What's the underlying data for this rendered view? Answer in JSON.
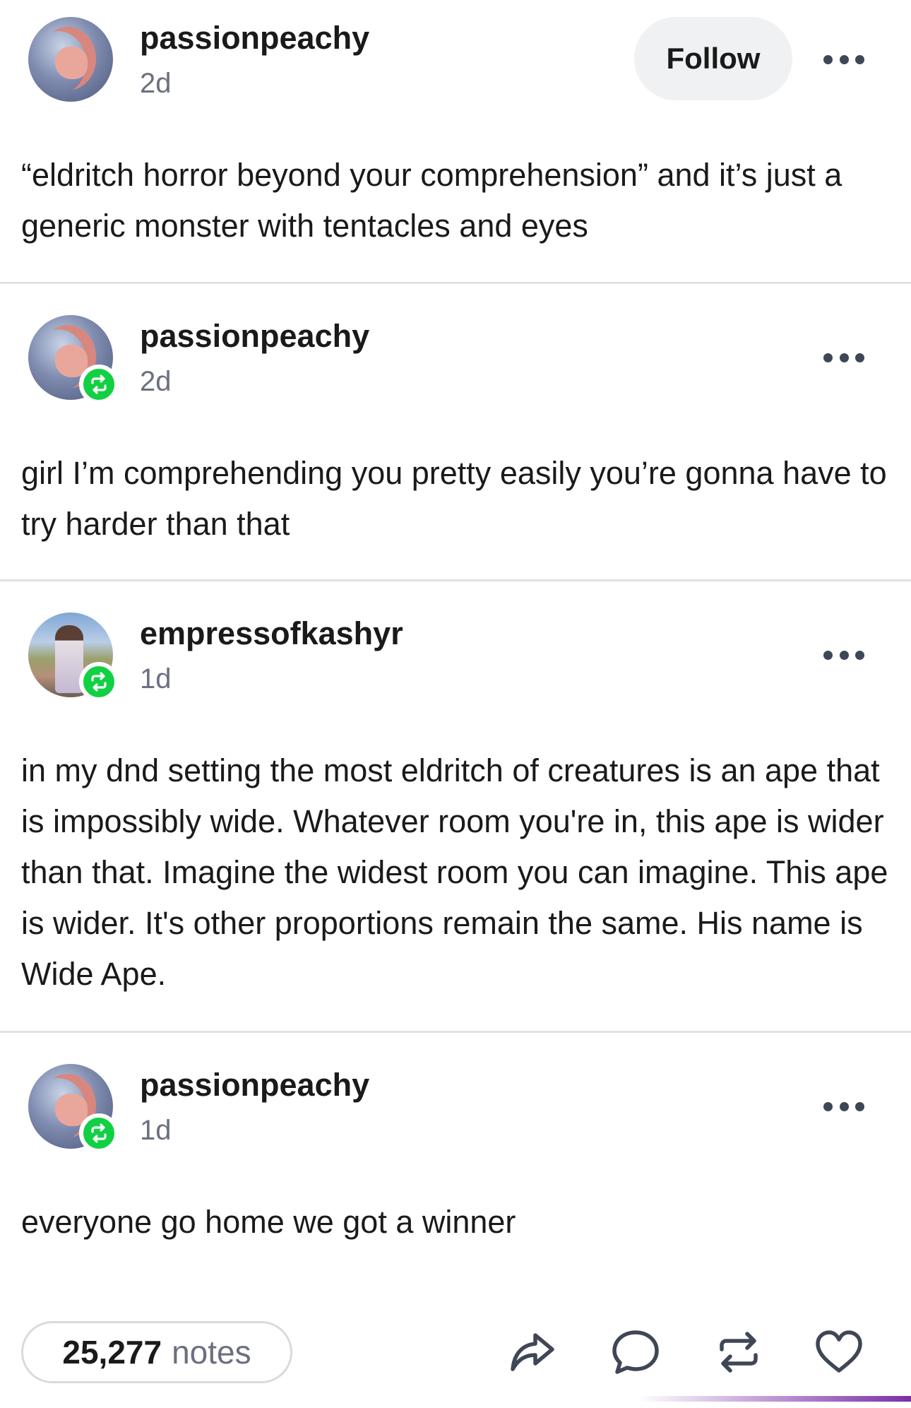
{
  "posts": [
    {
      "username": "passionpeachy",
      "time": "2d",
      "follow_label": "Follow",
      "text": "“eldritch horror beyond your comprehension” and it’s just a generic monster with tentacles and eyes"
    },
    {
      "username": "passionpeachy",
      "time": "2d",
      "text": "girl I’m comprehending you pretty easily you’re gonna have to try harder than that"
    },
    {
      "username": "empressofkashyr",
      "time": "1d",
      "text": "in my dnd setting the most eldritch of creatures is an ape that is impossibly wide. Whatever room you're in, this ape is wider than that. Imagine the widest room you can imagine. This ape is wider. It's other proportions remain the same. His name is Wide Ape."
    },
    {
      "username": "passionpeachy",
      "time": "1d",
      "text": "everyone go home we got a winner"
    }
  ],
  "footer": {
    "notes_count": "25,277",
    "notes_label": "notes",
    "actions": [
      "share-icon",
      "reply-icon",
      "reblog-icon",
      "like-icon"
    ]
  },
  "colors": {
    "reblog_badge": "#11d043",
    "icon_dark": "#3f4756",
    "muted_text": "#6b7080"
  }
}
